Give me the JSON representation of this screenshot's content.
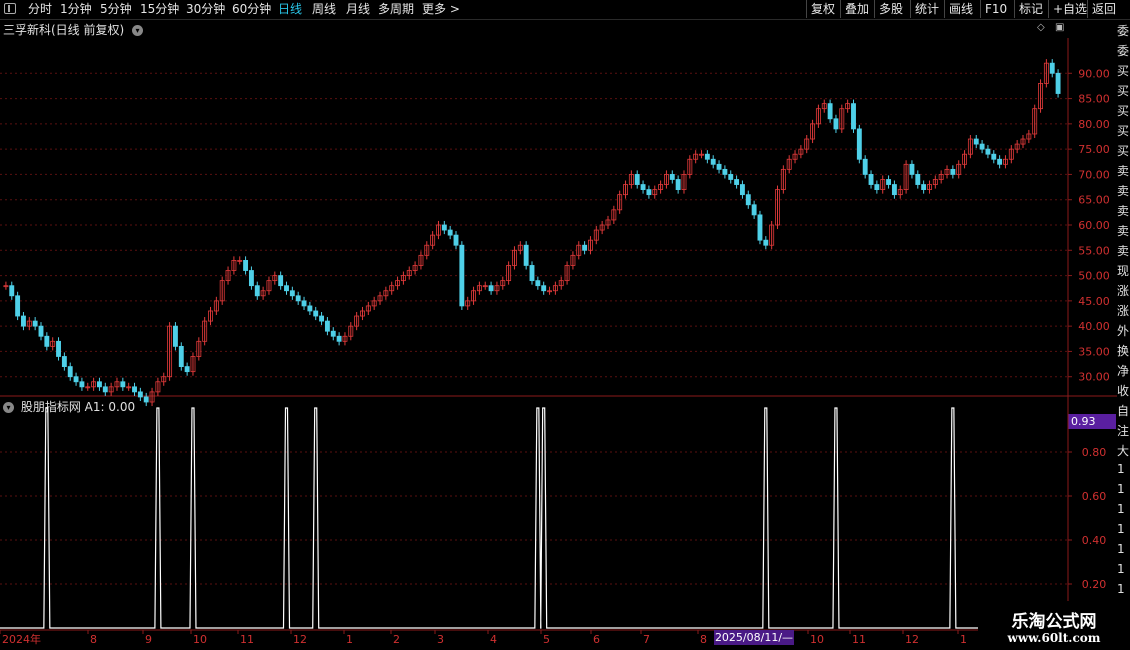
{
  "toolbar": {
    "periods": [
      {
        "label": "分时",
        "active": false
      },
      {
        "label": "1分钟",
        "active": false
      },
      {
        "label": "5分钟",
        "active": false
      },
      {
        "label": "15分钟",
        "active": false
      },
      {
        "label": "30分钟",
        "active": false
      },
      {
        "label": "60分钟",
        "active": false
      },
      {
        "label": "日线",
        "active": true
      },
      {
        "label": "周线",
        "active": false
      },
      {
        "label": "月线",
        "active": false
      },
      {
        "label": "多周期",
        "active": false
      },
      {
        "label": "更多 >",
        "active": false
      }
    ],
    "actions": [
      "复权",
      "叠加",
      "多股",
      "统计",
      "画线",
      "F10",
      "标记",
      "+自选",
      "返回"
    ]
  },
  "main_chart": {
    "title": "三孚新科(日线 前复权)",
    "y_ticks": [
      "90.00",
      "85.00",
      "80.00",
      "75.00",
      "70.00",
      "65.00",
      "60.00",
      "55.00",
      "50.00",
      "45.00",
      "40.00",
      "35.00",
      "30.00"
    ]
  },
  "indicator": {
    "title": "股朋指标网",
    "value_label": "A1: 0.00",
    "current_value": "0.93",
    "y_ticks": [
      "0.80",
      "0.60",
      "0.40",
      "0.20"
    ]
  },
  "x_axis": {
    "labels": [
      "2024年",
      "8",
      "9",
      "10",
      "11",
      "12",
      "1",
      "2",
      "3",
      "4",
      "5",
      "6",
      "7",
      "8",
      "10",
      "11",
      "12",
      "1"
    ],
    "selected_date": "2025/08/11/—"
  },
  "right_strip_text": [
    "委",
    "委",
    "买",
    "买",
    "买",
    "买",
    "买",
    "卖",
    "卖",
    "卖",
    "卖",
    "卖",
    "现",
    "涨",
    "涨",
    "外",
    "换",
    "净",
    "收",
    "自",
    "注",
    "大",
    "1",
    "1",
    "1",
    "1",
    "1",
    "1",
    "1",
    "1"
  ],
  "watermark": {
    "line1": "乐淘公式网",
    "line2": "www.60lt.com"
  },
  "chart_data": {
    "type": "candlestick",
    "price_ylim": [
      25,
      95
    ],
    "closes": [
      48,
      46,
      42,
      40,
      41,
      40,
      38,
      36,
      37,
      34,
      32,
      30,
      29,
      28,
      28,
      29,
      28,
      27,
      28,
      29,
      28,
      28,
      27,
      26,
      25,
      27,
      29,
      30,
      40,
      36,
      32,
      31,
      34,
      37,
      41,
      43,
      45,
      49,
      51,
      53,
      53,
      51,
      48,
      46,
      47,
      49,
      50,
      48,
      47,
      46,
      45,
      44,
      43,
      42,
      41,
      39,
      38,
      37,
      38,
      40,
      42,
      43,
      44,
      45,
      46,
      47,
      48,
      49,
      50,
      51,
      52,
      54,
      56,
      58,
      60,
      59,
      58,
      56,
      44,
      45,
      47,
      48,
      48,
      47,
      48,
      49,
      52,
      55,
      56,
      52,
      49,
      48,
      47,
      47,
      48,
      49,
      52,
      54,
      56,
      55,
      57,
      59,
      60,
      61,
      63,
      66,
      68,
      70,
      68,
      67,
      66,
      67,
      68,
      70,
      69,
      67,
      70,
      73,
      74,
      74,
      73,
      72,
      71,
      70,
      69,
      68,
      66,
      64,
      62,
      57,
      56,
      60,
      67,
      71,
      73,
      74,
      75,
      77,
      80,
      83,
      84,
      81,
      79,
      83,
      84,
      79,
      73,
      70,
      68,
      67,
      69,
      68,
      66,
      67,
      72,
      70,
      68,
      67,
      68,
      69,
      70,
      71,
      70,
      72,
      74,
      77,
      76,
      75,
      74,
      73,
      72,
      73,
      75,
      76,
      77,
      78,
      83,
      88,
      92,
      90,
      86
    ],
    "signal_indices": [
      7,
      26,
      32,
      48,
      53,
      91,
      92,
      130,
      142,
      162
    ],
    "indicator_ylim": [
      0,
      1.0
    ]
  }
}
